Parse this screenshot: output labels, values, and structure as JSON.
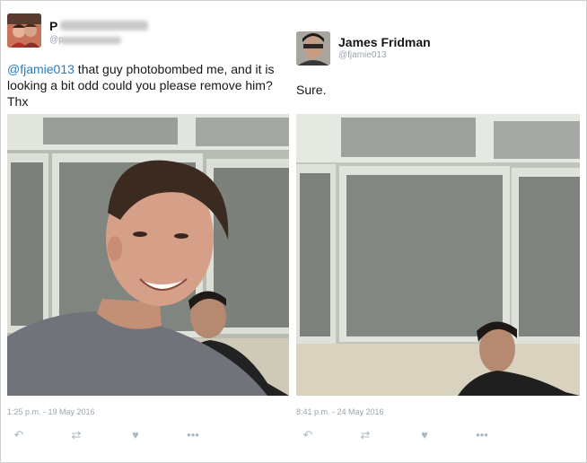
{
  "left_tweet": {
    "author_name": "P",
    "author_handle": "@p",
    "mention": "@fjamie013",
    "text": " that guy photobombed me, and it is looking a bit odd could you please remove him? Thx",
    "timestamp": "1:25 p.m. - 19 May 2016",
    "icons": [
      "reply-icon",
      "retweet-icon",
      "like-icon",
      "more-icon"
    ]
  },
  "right_tweet": {
    "author_name": "James Fridman",
    "author_handle": "@fjamie013",
    "text": "Sure.",
    "timestamp": "8:41 p.m. - 24 May 2016",
    "icons": [
      "reply-icon",
      "retweet-icon",
      "like-icon",
      "more-icon"
    ]
  },
  "colors": {
    "mention": "#2b7bb9",
    "text": "#14171a",
    "meta": "#9aa5b0",
    "action_icons": "#aab8c2"
  }
}
